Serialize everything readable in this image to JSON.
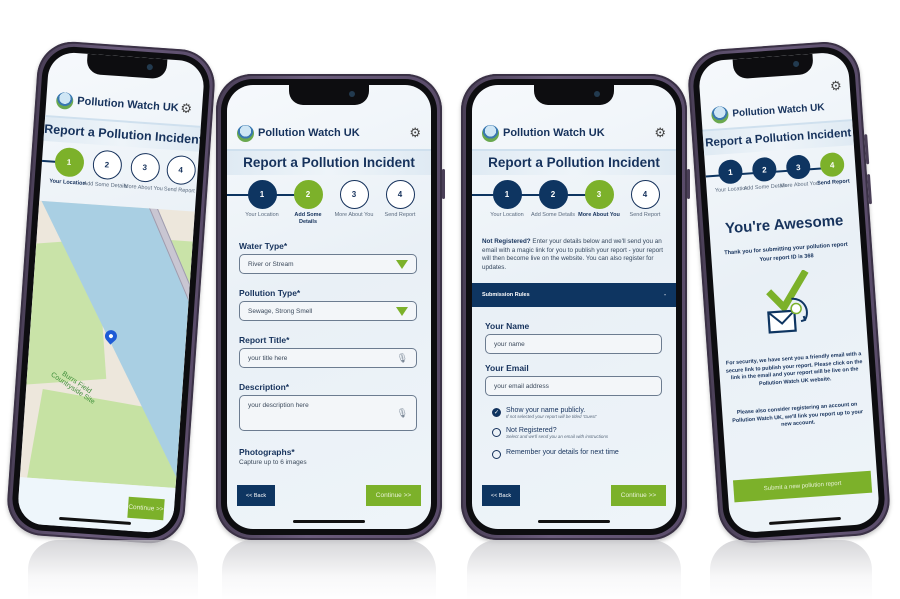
{
  "app": {
    "brand": "Pollution Watch UK",
    "page_title": "Report a Pollution Incident",
    "settings_icon": "gear-icon",
    "logo_icon": "pollution-watch-logo-icon"
  },
  "steps": [
    {
      "number": "1",
      "label": "Your Location"
    },
    {
      "number": "2",
      "label": "Add Some Details"
    },
    {
      "number": "3",
      "label": "More About You"
    },
    {
      "number": "4",
      "label": "Send Report"
    }
  ],
  "colors": {
    "navy": "#0e3561",
    "green": "#7cb12a",
    "text": "#16325c"
  },
  "screen1": {
    "current_step": 1,
    "map": {
      "place_label": "Burrs Field Countryside Site",
      "pin_icon": "map-pin-icon"
    },
    "continue_label": "Continue >>"
  },
  "screen2": {
    "current_step": 2,
    "water_type": {
      "label": "Water Type*",
      "value": "River or Stream"
    },
    "pollution_type": {
      "label": "Pollution Type*",
      "value": "Sewage, Strong Smell"
    },
    "report_title": {
      "label": "Report Title*",
      "placeholder": "your title here"
    },
    "description": {
      "label": "Description*",
      "placeholder": "your description here"
    },
    "photographs": {
      "label": "Photographs*",
      "hint": "Capture up to 6 images"
    },
    "back_label": "<< Back",
    "continue_label": "Continue >>"
  },
  "screen3": {
    "current_step": 3,
    "intro_bold": "Not Registered?",
    "intro_text": " Enter your details below and we'll send you an email with a magic link for you to publish your report - your report will then become live on the website. You can also register for updates.",
    "accordion_label": "Submission Rules",
    "accordion_toggle": "-",
    "name": {
      "label": "Your Name",
      "placeholder": "your name"
    },
    "email": {
      "label": "Your Email",
      "placeholder": "your email address"
    },
    "options": [
      {
        "label": "Show your name publicly.",
        "hint": "If not selected your report will be titled 'Guest'",
        "checked": true
      },
      {
        "label": "Not Registered?",
        "hint": "Select and we'll send you an email with instructions",
        "checked": false
      },
      {
        "label": "Remember your details for next time",
        "hint": "",
        "checked": false
      }
    ],
    "back_label": "<< Back",
    "continue_label": "Continue >>"
  },
  "screen4": {
    "current_step": 4,
    "heading": "You're Awesome",
    "thanks_line": "Thank you for submitting your pollution report",
    "report_id_line": "Your report ID is 368",
    "illustration_icon": "email-check-icon",
    "security_text": "For security, we have sent you a friendly email with a secure link to publish your report. Please click on the link in the email and your report will be live on the Pollution Watch UK website.",
    "register_text": "Please also consider registering an account on Pollution Watch UK, we'll link you report up to your new account.",
    "submit_new_label": "Submit a new pollution report"
  }
}
